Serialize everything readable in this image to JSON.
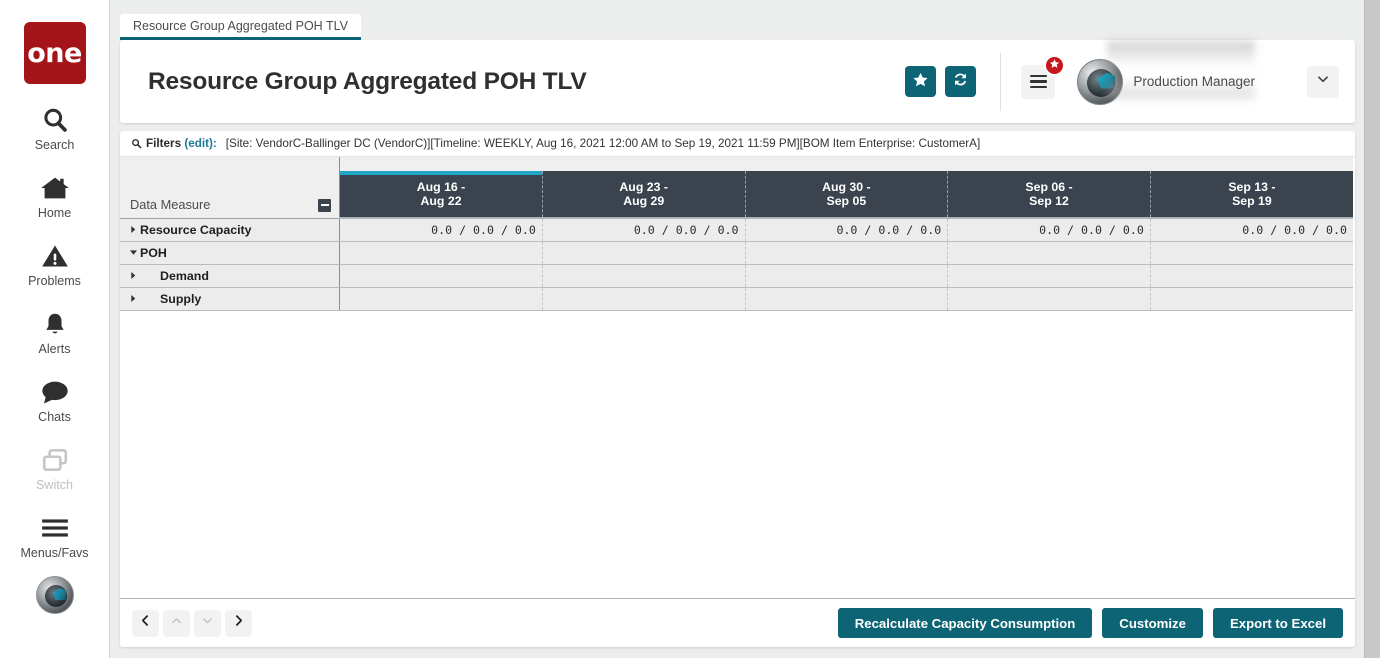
{
  "sidebar": {
    "logo_text": "one",
    "items": [
      {
        "label": "Search",
        "icon": "search-icon",
        "dim": false
      },
      {
        "label": "Home",
        "icon": "home-icon",
        "dim": false
      },
      {
        "label": "Problems",
        "icon": "warning-icon",
        "dim": false
      },
      {
        "label": "Alerts",
        "icon": "bell-icon",
        "dim": false
      },
      {
        "label": "Chats",
        "icon": "chat-icon",
        "dim": false
      },
      {
        "label": "Switch",
        "icon": "switch-icon",
        "dim": true
      },
      {
        "label": "Menus/Favs",
        "icon": "hamburger-icon",
        "dim": false
      }
    ]
  },
  "tab": {
    "label": "Resource Group Aggregated POH TLV"
  },
  "header": {
    "title": "Resource Group Aggregated POH TLV",
    "favorite_icon": "star-icon",
    "refresh_icon": "refresh-icon",
    "menu_icon": "hamburger-icon",
    "badge_icon": "star-icon",
    "avatar_icon": "avatar",
    "user_role": "Production Manager",
    "dropdown_icon": "chevron-down-icon"
  },
  "filters": {
    "search_icon": "search-icon",
    "label": "Filters",
    "edit_label": "(edit):",
    "value": "[Site: VendorC-Ballinger DC (VendorC)][Timeline: WEEKLY, Aug 16, 2021 12:00 AM to Sep 19, 2021 11:59 PM][BOM Item Enterprise: CustomerA]"
  },
  "table": {
    "measure_header": "Data Measure",
    "collapse_icon": "minus-square-icon",
    "columns": [
      {
        "line1": "Aug 16 -",
        "line2": "Aug 22",
        "accent": true
      },
      {
        "line1": "Aug 23 -",
        "line2": "Aug 29",
        "accent": false
      },
      {
        "line1": "Aug 30 -",
        "line2": "Sep 05",
        "accent": false
      },
      {
        "line1": "Sep 06 -",
        "line2": "Sep 12",
        "accent": false
      },
      {
        "line1": "Sep 13 -",
        "line2": "Sep 19",
        "accent": false
      }
    ],
    "rows": [
      {
        "label": "Resource Capacity",
        "state": "collapsed",
        "indent": 0,
        "values": [
          "0.0 / 0.0 / 0.0",
          "0.0 / 0.0 / 0.0",
          "0.0 / 0.0 / 0.0",
          "0.0 / 0.0 / 0.0",
          "0.0 / 0.0 / 0.0"
        ]
      },
      {
        "label": "POH",
        "state": "expanded",
        "indent": 0,
        "values": [
          "",
          "",
          "",
          "",
          ""
        ]
      },
      {
        "label": "Demand",
        "state": "collapsed",
        "indent": 1,
        "values": [
          "",
          "",
          "",
          "",
          ""
        ]
      },
      {
        "label": "Supply",
        "state": "collapsed",
        "indent": 1,
        "values": [
          "",
          "",
          "",
          "",
          ""
        ]
      }
    ]
  },
  "footer": {
    "nav": [
      {
        "icon": "chevron-left-icon",
        "name": "page-first-button",
        "enabled": true
      },
      {
        "icon": "chevron-up-icon",
        "name": "page-up-button",
        "enabled": false
      },
      {
        "icon": "chevron-down-icon",
        "name": "page-down-button",
        "enabled": false
      },
      {
        "icon": "chevron-right-icon",
        "name": "page-next-button",
        "enabled": true
      }
    ],
    "recalculate_label": "Recalculate Capacity Consumption",
    "customize_label": "Customize",
    "export_label": "Export to Excel"
  },
  "colors": {
    "brand_red": "#a41419",
    "teal": "#0d6474",
    "header_dark": "#3b444e",
    "accent_cyan": "#1fa6c4",
    "badge_red": "#c7161d"
  }
}
